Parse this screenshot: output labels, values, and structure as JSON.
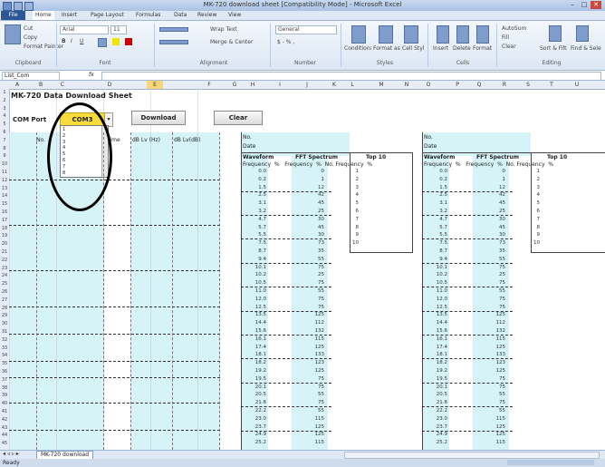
{
  "window": {
    "title": "MK-720 download sheet [Compatibility Mode] - Microsoft Excel",
    "minimize": "–",
    "maximize": "□",
    "close": "✕"
  },
  "ribbon_tabs": [
    "File",
    "Home",
    "Insert",
    "Page Layout",
    "Formulas",
    "Data",
    "Review",
    "View"
  ],
  "ribbon": {
    "clipboard": {
      "cut": "Cut",
      "copy": "Copy",
      "format_painter": "Format Painter",
      "label": "Clipboard"
    },
    "font": {
      "name": "Arial",
      "size": "11",
      "label": "Font"
    },
    "alignment": {
      "wrap": "Wrap Text",
      "merge": "Merge & Center",
      "label": "Alignment"
    },
    "number": {
      "format": "General",
      "label": "Number"
    },
    "styles": {
      "conditional": "Conditional Formatting",
      "table": "Format as Table",
      "cell": "Cell Styles",
      "label": "Styles"
    },
    "cells": {
      "insert": "Insert",
      "delete": "Delete",
      "format": "Format",
      "label": "Cells"
    },
    "editing": {
      "autosum": "AutoSum",
      "fill": "Fill",
      "clear": "Clear",
      "sort": "Sort & Filter",
      "find": "Find & Select",
      "label": "Editing"
    }
  },
  "formula_bar": {
    "name_box": "List_Com",
    "fx": "fx",
    "value": ""
  },
  "columns": [
    "A",
    "B",
    "C",
    "D",
    "E",
    "F",
    "G",
    "H",
    "I",
    "J",
    "K",
    "L",
    "M",
    "N",
    "O",
    "P",
    "Q",
    "R",
    "S",
    "T",
    "U"
  ],
  "rows": [
    "1",
    "2",
    "3",
    "4",
    "5",
    "6",
    "7",
    "8",
    "9",
    "10",
    "11",
    "12",
    "13",
    "14",
    "15",
    "16",
    "17",
    "18",
    "19",
    "20",
    "21",
    "22",
    "23",
    "24",
    "25",
    "26",
    "27",
    "28",
    "29",
    "30",
    "31",
    "32",
    "33",
    "34",
    "35",
    "36",
    "37",
    "38",
    "39",
    "40",
    "41",
    "42",
    "43",
    "44",
    "45"
  ],
  "sheet": {
    "title": "MK-720 Data Download Sheet",
    "com_port_label": "COM Port",
    "com_port_value": "COM3",
    "download_button": "Download",
    "clear_button": "Clear",
    "list_headers": [
      "No.",
      "Time",
      "dB Lv (Hz)",
      "dB Lv(dB)"
    ],
    "dropdown_items": [
      "1",
      "2",
      "3",
      "4",
      "5",
      "6",
      "7",
      "8"
    ],
    "panel1": {
      "no_label": "No.",
      "date_label": "Date",
      "waveform": "Waveform",
      "fft": "FFT Spectrum",
      "top10": "Top 10",
      "sub": [
        "Frequency",
        "%",
        "Frequency",
        "%",
        "No.",
        "Frequency",
        "%"
      ]
    },
    "panel2": {
      "no_label": "No.",
      "date_label": "Date",
      "waveform": "Waveform",
      "fft": "FFT Spectrum",
      "top10": "Top 10",
      "sub": [
        "Frequency",
        "%",
        "Frequency",
        "%",
        "No.",
        "Frequency",
        "%"
      ]
    },
    "freq_values": [
      "0.0",
      "0.2",
      "1.5",
      "2.5",
      "3.1",
      "3.2",
      "4.7",
      "5.7",
      "5.5",
      "7.5",
      "8.7",
      "9.4",
      "10.1",
      "10.2",
      "10.5",
      "11.0",
      "12.0",
      "12.5",
      "13.5",
      "14.4",
      "15.6",
      "16.1",
      "17.4",
      "18.1",
      "18.2",
      "19.2",
      "19.5",
      "20.1",
      "20.5",
      "21.6",
      "22.2",
      "23.0",
      "23.7",
      "24.9",
      "25.2"
    ],
    "fft_values": [
      "0",
      "1",
      "12",
      "42",
      "45",
      "25",
      "30",
      "45",
      "30",
      "73",
      "35",
      "55",
      "75",
      "25",
      "75",
      "55",
      "75",
      "75",
      "125",
      "112",
      "132",
      "115",
      "125",
      "133",
      "123",
      "125",
      "75",
      "75",
      "55",
      "75",
      "55",
      "115",
      "125",
      "125",
      "115"
    ],
    "top10_nos": [
      "1",
      "2",
      "3",
      "4",
      "5",
      "6",
      "7",
      "8",
      "9",
      "10"
    ]
  },
  "sheet_tab": "MK-720 download",
  "status_left": "Ready"
}
